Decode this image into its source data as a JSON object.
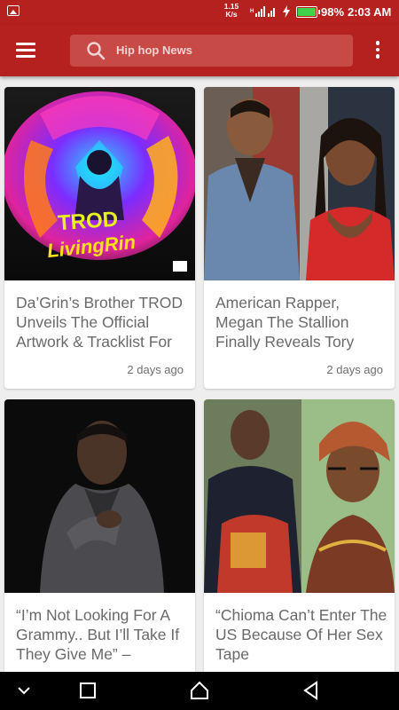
{
  "status": {
    "net_speed_value": "1.15",
    "net_speed_unit": "K/s",
    "battery": "98%",
    "time": "2:03 AM",
    "battery_color": "#3fd24a"
  },
  "app_bar": {
    "search_placeholder": "Hip hop News",
    "bg_color": "#b5211f"
  },
  "articles": [
    {
      "title": "Da’Grin’s Brother TROD Unveils The Official Artwork & Tracklist For",
      "time": "2 days ago",
      "image": "album-cover-image"
    },
    {
      "title": "American Rapper, Megan The Stallion Finally Reveals Tory",
      "time": "2 days ago",
      "image": "rappers-photo"
    },
    {
      "title": "“I’m Not Looking For A Grammy.. But I’ll Take If They Give Me” –",
      "time": "",
      "image": "artist-portrait"
    },
    {
      "title": "“Chioma Can’t Enter The US Because Of Her Sex Tape",
      "time": "",
      "image": "couple-photo"
    }
  ]
}
